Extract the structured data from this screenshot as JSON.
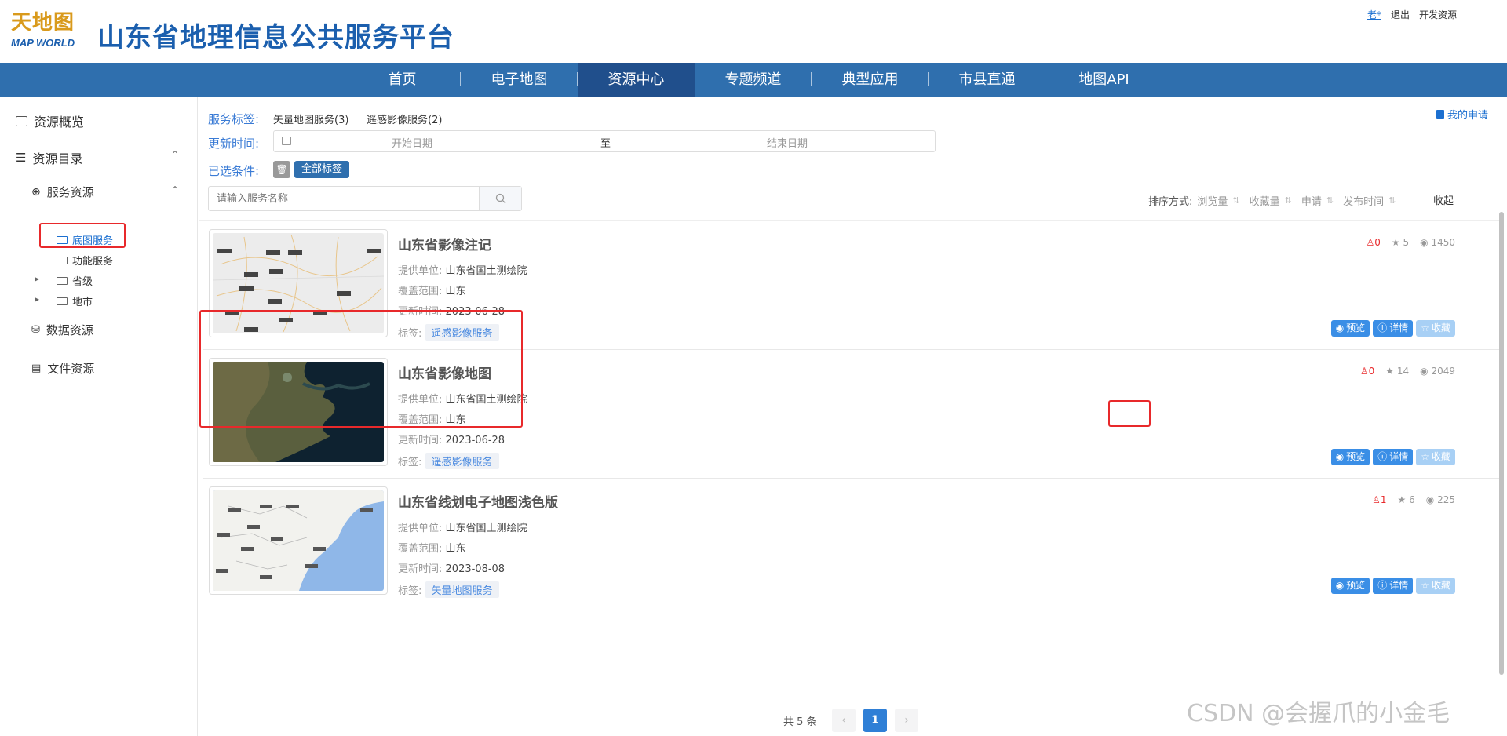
{
  "header": {
    "logo_cn": "天地图",
    "logo_en": "MAP WORLD",
    "title": "山东省地理信息公共服务平台",
    "user_link": "老*",
    "logout": "退出",
    "dev_resource": "开发资源"
  },
  "nav": {
    "items": [
      {
        "label": "首页",
        "active": false
      },
      {
        "label": "电子地图",
        "active": false
      },
      {
        "label": "资源中心",
        "active": true
      },
      {
        "label": "专题频道",
        "active": false
      },
      {
        "label": "典型应用",
        "active": false
      },
      {
        "label": "市县直通",
        "active": false
      },
      {
        "label": "地图API",
        "active": false
      }
    ]
  },
  "sidebar": {
    "overview": "资源概览",
    "catalog": "资源目录",
    "service_res": "服务资源",
    "basemap": "底图服务",
    "function": "功能服务",
    "province": "省级",
    "city": "地市",
    "data_res": "数据资源",
    "file_res": "文件资源"
  },
  "filters": {
    "tag_label": "服务标签:",
    "tag_opts": [
      "矢量地图服务(3)",
      "遥感影像服务(2)"
    ],
    "time_label": "更新时间:",
    "start_placeholder": "开始日期",
    "to": "至",
    "end_placeholder": "结束日期",
    "selected_label": "已选条件:",
    "all_tags": "全部标签",
    "search_placeholder": "请输入服务名称",
    "my_apply": "我的申请"
  },
  "sort": {
    "label": "排序方式:",
    "opts": [
      "浏览量",
      "收藏量",
      "申请",
      "发布时间"
    ],
    "collapse": "收起"
  },
  "meta_keys": {
    "provider": "提供单位:",
    "coverage": "覆盖范围:",
    "updated": "更新时间:",
    "tags": "标签:"
  },
  "buttons": {
    "preview": "预览",
    "detail": "详情",
    "favorite": "收藏"
  },
  "cards": [
    {
      "title": "山东省影像注记",
      "provider": "山东省国土测绘院",
      "coverage": "山东",
      "updated": "2023-06-28",
      "tag": "遥感影像服务",
      "applies": "0",
      "stars": "5",
      "views": "1450"
    },
    {
      "title": "山东省影像地图",
      "provider": "山东省国土测绘院",
      "coverage": "山东",
      "updated": "2023-06-28",
      "tag": "遥感影像服务",
      "applies": "0",
      "stars": "14",
      "views": "2049"
    },
    {
      "title": "山东省线划电子地图浅色版",
      "provider": "山东省国土测绘院",
      "coverage": "山东",
      "updated": "2023-08-08",
      "tag": "矢量地图服务",
      "applies": "1",
      "stars": "6",
      "views": "225"
    }
  ],
  "pagination": {
    "total": "共 5 条",
    "current": "1",
    "prev": "‹",
    "next": "›"
  },
  "watermark": "CSDN @会握爪的小金毛",
  "colors": {
    "brand_blue": "#1b5fae",
    "nav_bg": "#2f6fae",
    "nav_active": "#204f8c",
    "highlight_red": "#e8292b",
    "button_blue": "#3a8ee6"
  }
}
